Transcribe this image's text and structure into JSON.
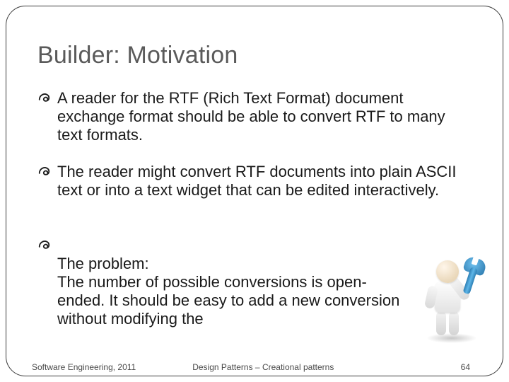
{
  "title": "Builder: Motivation",
  "bullets": [
    " A reader for the RTF (Rich Text Format) document exchange format should be able to convert RTF to many text formats.",
    "The reader might convert RTF documents into plain ASCII text or into a text widget that can be edited interactively.",
    "The problem:\nThe number of possible conversions is open-ended. It should be easy to add a new conversion without modifying the"
  ],
  "footer": {
    "left": "Software Engineering, 2011",
    "center": "Design Patterns – Creational patterns",
    "page": "64"
  }
}
